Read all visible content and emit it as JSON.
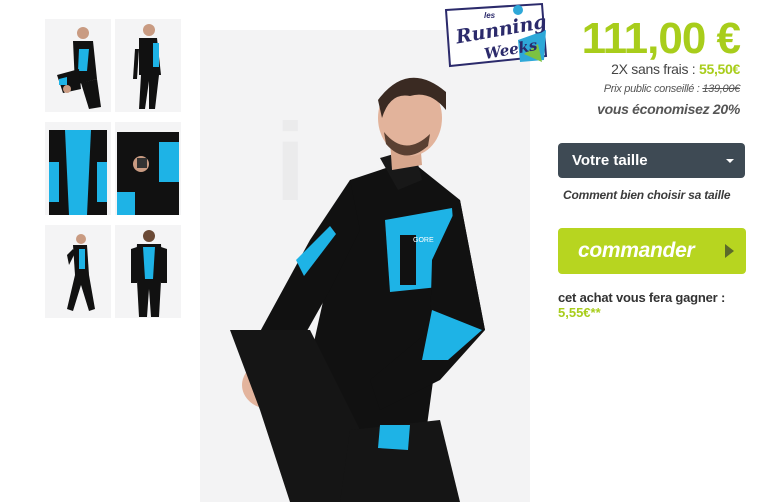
{
  "product": {
    "price": "111,00 €",
    "installments_label": "2X sans frais :",
    "installments_value": "55,50€",
    "rrp_label": "Prix public conseillé :",
    "rrp_value": "139,00€",
    "saving": "vous économisez 20%"
  },
  "badge": {
    "line1": "les",
    "line2": "Running",
    "line3": "Weeks"
  },
  "size_select": {
    "selected": "Votre taille",
    "help_link": "Comment bien choisir sa taille"
  },
  "order_button": {
    "label": "commander"
  },
  "loyalty": {
    "text": "cet achat vous fera gagner :",
    "value": "5,55€**"
  },
  "main_image": {
    "logo_text": "GORE"
  },
  "colors": {
    "accent_green": "#a8cd1b",
    "button_green": "#b7d520",
    "select_dark": "#3e4a54",
    "jacket_black": "#111111",
    "jacket_blue": "#1eb3e6"
  },
  "icons": {
    "select_caret": "caret-down-icon",
    "order_arrow": "play-arrow-icon"
  }
}
